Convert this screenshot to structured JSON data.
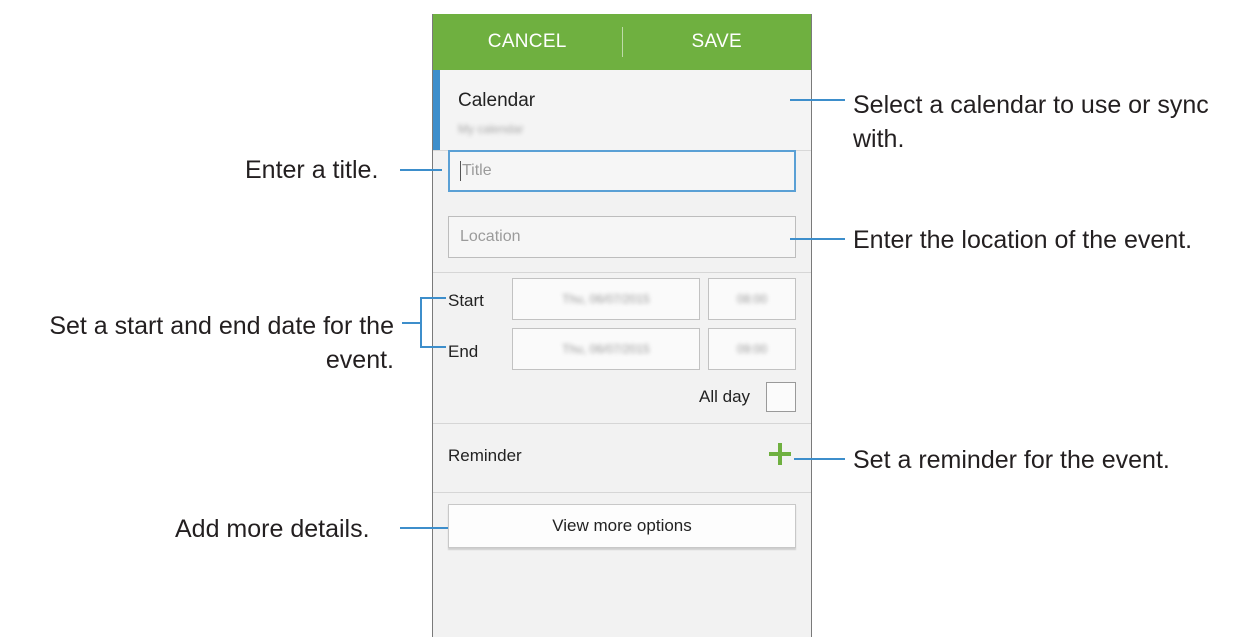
{
  "actionbar": {
    "cancel": "CANCEL",
    "save": "SAVE"
  },
  "calendar": {
    "label": "Calendar",
    "account": "My calendar"
  },
  "title_field": {
    "placeholder": "Title"
  },
  "location_field": {
    "placeholder": "Location"
  },
  "start": {
    "label": "Start",
    "date": "Thu, 06/07/2015",
    "time": "08:00"
  },
  "end": {
    "label": "End",
    "date": "Thu, 06/07/2015",
    "time": "09:00"
  },
  "all_day": {
    "label": "All day",
    "checked": false
  },
  "reminder": {
    "label": "Reminder"
  },
  "more_options": {
    "label": "View more options"
  },
  "callouts": {
    "calendar": "Select a calendar to use or sync with.",
    "title": "Enter a title.",
    "location": "Enter the location of the event.",
    "dates_line1": "Set a start and end date for the",
    "dates_line2": "event.",
    "reminder": "Set a reminder for the event.",
    "details": "Add more details."
  },
  "colors": {
    "actionbar": "#6fb040",
    "accent": "#3d8ecb",
    "plus": "#6fb040"
  }
}
